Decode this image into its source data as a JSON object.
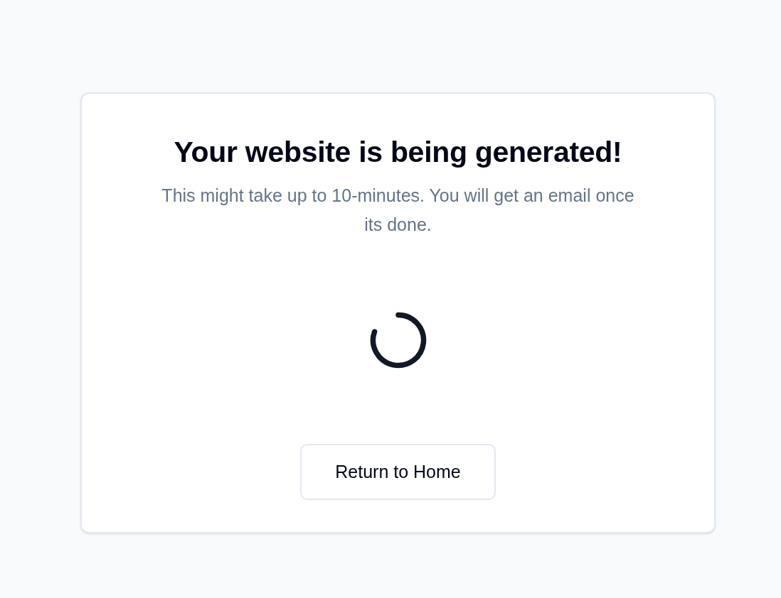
{
  "card": {
    "title": "Your website is being generated!",
    "message": "This might take up to 10-minutes. You will get an email once its done.",
    "loading": true,
    "button": "Return to Home"
  }
}
